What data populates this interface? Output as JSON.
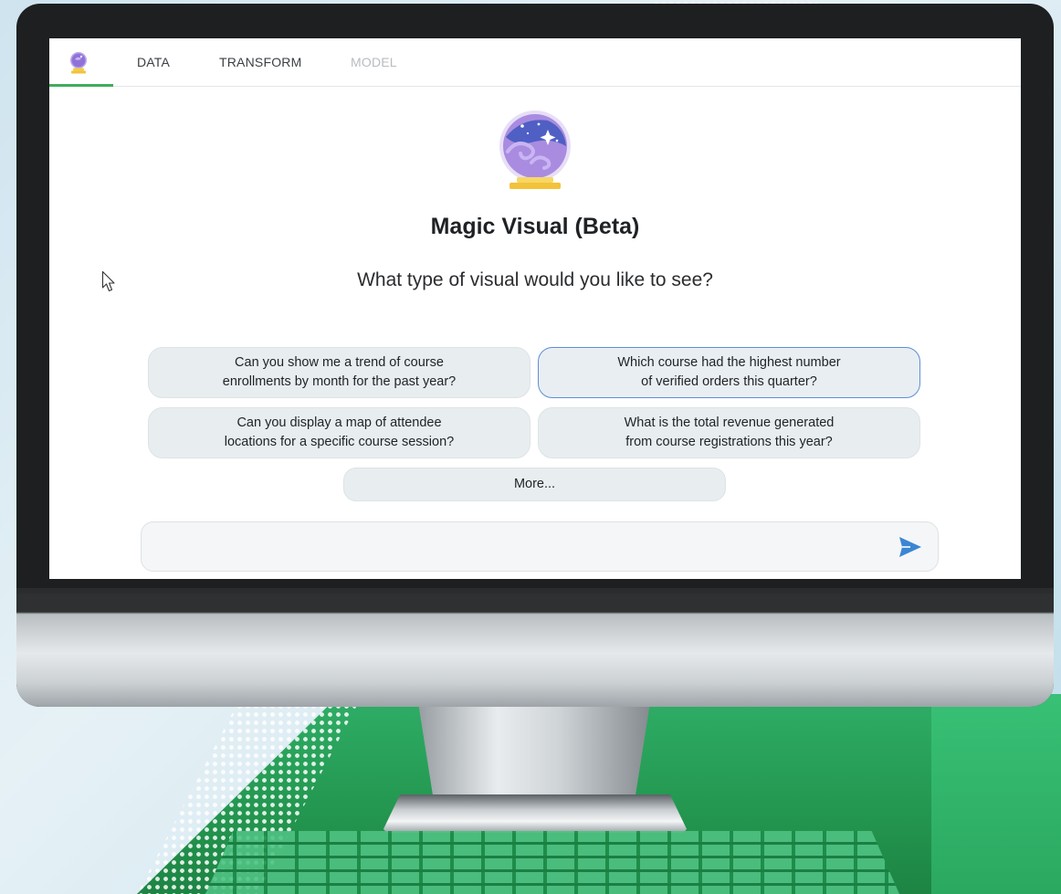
{
  "tabs": [
    {
      "label": "DATA",
      "enabled": true
    },
    {
      "label": "TRANSFORM",
      "enabled": true
    },
    {
      "label": "MODEL",
      "enabled": false
    }
  ],
  "icons": {
    "home_tab": "crystal-ball-icon",
    "hero": "crystal-ball-icon",
    "send": "send-icon",
    "cursor": "mouse-pointer-icon"
  },
  "main": {
    "title": "Magic Visual (Beta)",
    "subtitle": "What type of visual would you like to see?"
  },
  "suggestions": [
    {
      "text": "Can you show me a trend of course\nenrollments by month for the past year?",
      "active": false
    },
    {
      "text": "Which course had the highest number\nof verified orders this quarter?",
      "active": true
    },
    {
      "text": "Can you display a map of attendee\nlocations for a specific course session?",
      "active": false
    },
    {
      "text": "What is the total revenue generated\nfrom course registrations this year?",
      "active": false
    }
  ],
  "more_label": "More...",
  "prompt": {
    "value": "",
    "placeholder": ""
  },
  "colors": {
    "active_tab_underline": "#3fae5a",
    "send_icon": "#3a86d4",
    "chip_bg": "#e8edf0",
    "chip_active_border": "#5b8fd6",
    "crystal_ball": "#a98ce0",
    "ball_base": "#f5cd4a"
  }
}
